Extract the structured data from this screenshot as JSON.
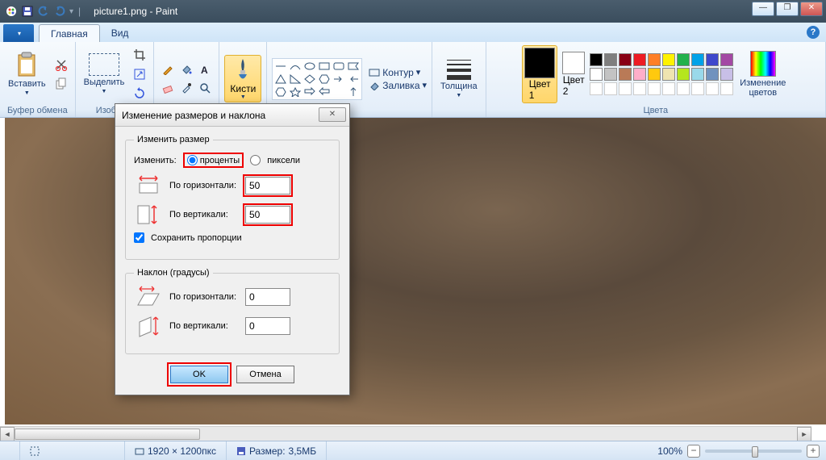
{
  "title": {
    "filename": "picture1.png",
    "app": "Paint"
  },
  "tabs": {
    "main": "Главная",
    "view": "Вид"
  },
  "ribbon": {
    "clipboard": {
      "paste": "Вставить",
      "group": "Буфер обмена"
    },
    "image": {
      "select": "Выделить",
      "group": "Изобра..."
    },
    "tools": {
      "brushes": "Кисти",
      "group": ""
    },
    "shapes": {
      "contour": "Контур",
      "fill": "Заливка",
      "group": ""
    },
    "thickness": {
      "label": "Толщина"
    },
    "color1": {
      "label": "Цвет\n1"
    },
    "color2": {
      "label": "Цвет\n2"
    },
    "colors_group": "Цвета",
    "edit_colors": "Изменение\nцветов",
    "palette_row1": [
      "#000000",
      "#7f7f7f",
      "#880015",
      "#ed1c24",
      "#ff7f27",
      "#fff200",
      "#22b14c",
      "#00a2e8",
      "#3f48cc",
      "#a349a4"
    ],
    "palette_row2": [
      "#ffffff",
      "#c3c3c3",
      "#b97a57",
      "#ffaec9",
      "#ffc90e",
      "#efe4b0",
      "#b5e61d",
      "#99d9ea",
      "#7092be",
      "#c8bfe7"
    ]
  },
  "dialog": {
    "title": "Изменение размеров и наклона",
    "resize_legend": "Изменить размер",
    "resize_by": "Изменить:",
    "percent": "проценты",
    "pixels": "пиксели",
    "horizontal": "По горизонтали:",
    "vertical": "По вертикали:",
    "h_value": "50",
    "v_value": "50",
    "keep_ratio": "Сохранить пропорции",
    "skew_legend": "Наклон (градусы)",
    "skew_h": "0",
    "skew_v": "0",
    "ok": "OK",
    "cancel": "Отмена"
  },
  "status": {
    "dims": "1920 × 1200пкс",
    "size_label": "Размер:",
    "size": "3,5МБ",
    "zoom": "100%"
  }
}
